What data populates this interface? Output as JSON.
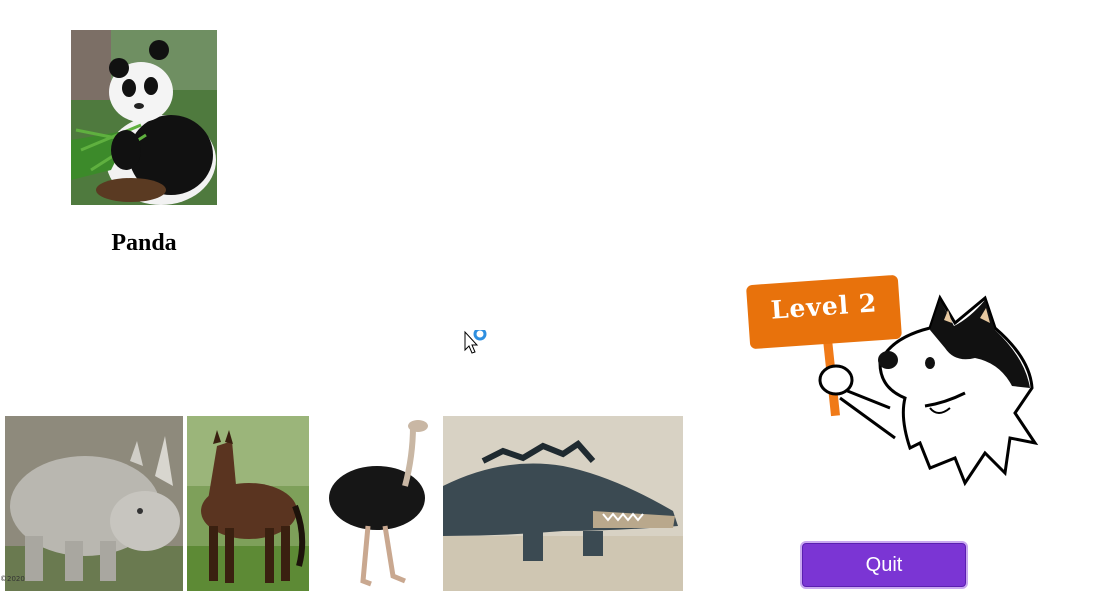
{
  "target": {
    "label": "Panda",
    "photo_icon": "panda-photo"
  },
  "choices": [
    {
      "id": "rhino",
      "icon": "rhino-photo"
    },
    {
      "id": "horse",
      "icon": "horse-photo"
    },
    {
      "id": "ostrich",
      "icon": "ostrich-photo"
    },
    {
      "id": "crocodile",
      "icon": "crocodile-photo"
    }
  ],
  "level": {
    "sign_text": "Level 2"
  },
  "buttons": {
    "quit_label": "Quit"
  },
  "footer": {
    "copyright": "©2020"
  },
  "colors": {
    "quit_button": "#7b35d4",
    "level_sign": "#e8720c",
    "loading_ring": "#2e8fe0"
  }
}
